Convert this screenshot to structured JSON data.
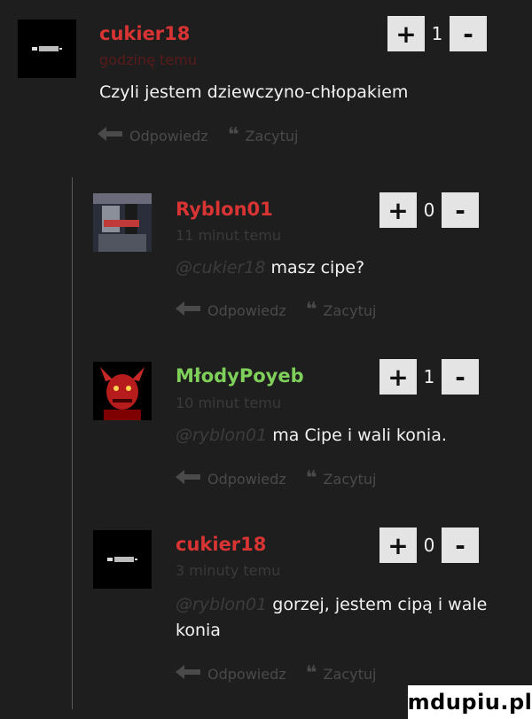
{
  "comments": [
    {
      "username": "cukier18",
      "username_color": "#d83434",
      "time": "godzinę temu",
      "time_color": "#5a1a1a",
      "mention": "",
      "text": "Czyli jestem dziewczyno-chłopakiem",
      "score": "1",
      "avatar": "cukier-avatar"
    },
    {
      "username": "Ryblon01",
      "username_color": "#d83434",
      "time": "11 minut temu",
      "time_color": "#3a3a3a",
      "mention": "@cukier18",
      "text": "masz cipe?",
      "score": "0",
      "avatar": "ryblon-avatar"
    },
    {
      "username": "MłodyPoyeb",
      "username_color": "#7fd05a",
      "time": "10 minut temu",
      "time_color": "#3a3a3a",
      "mention": "@ryblon01",
      "text": "ma Cipe i wali konia.",
      "score": "1",
      "avatar": "mlody-avatar"
    },
    {
      "username": "cukier18",
      "username_color": "#d83434",
      "time": "3 minuty temu",
      "time_color": "#3a3a3a",
      "mention": "@ryblon01",
      "text": "gorzej, jestem cipą i wale konia",
      "score": "0",
      "avatar": "cukier-avatar"
    }
  ],
  "actions": {
    "reply": "Odpowiedz",
    "quote": "Zacytuj",
    "upvote": "+",
    "downvote": "-"
  },
  "watermark": "mdupiu.pl"
}
